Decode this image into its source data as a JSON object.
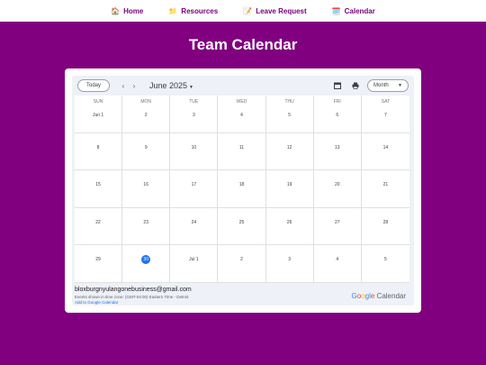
{
  "nav": {
    "items": [
      {
        "icon": "🏠",
        "label": "Home"
      },
      {
        "icon": "📁",
        "label": "Resources"
      },
      {
        "icon": "📝",
        "label": "Leave Request"
      },
      {
        "icon": "🗓️",
        "label": "Calendar"
      }
    ]
  },
  "page": {
    "title": "Team Calendar"
  },
  "calendar": {
    "today_label": "Today",
    "prev_icon": "‹",
    "next_icon": "›",
    "month": "June 2025",
    "view": "Month",
    "weekdays": [
      "SUN",
      "MON",
      "TUE",
      "WED",
      "THU",
      "FRI",
      "SAT"
    ],
    "weeks": [
      [
        "Jun 1",
        "2",
        "3",
        "4",
        "5",
        "6",
        "7"
      ],
      [
        "8",
        "9",
        "10",
        "11",
        "12",
        "13",
        "14"
      ],
      [
        "15",
        "16",
        "17",
        "18",
        "19",
        "20",
        "21"
      ],
      [
        "22",
        "23",
        "24",
        "25",
        "26",
        "27",
        "28"
      ],
      [
        "29",
        "30",
        "Jul 1",
        "2",
        "3",
        "4",
        "5"
      ]
    ],
    "today_index": [
      4,
      1
    ]
  },
  "footer": {
    "email": "bloxburgnyulangonebusiness@gmail.com",
    "timezone": "Events shown in time zone: (GMT-04:00) Eastern Time - Detroit",
    "add_link": "Add to Google Calendar",
    "logo_letters": [
      "G",
      "o",
      "o",
      "g",
      "l",
      "e"
    ],
    "logo_colors": [
      "#4285F4",
      "#EA4335",
      "#FBBC05",
      "#4285F4",
      "#34A853",
      "#EA4335"
    ],
    "logo_suffix": "Calendar"
  }
}
